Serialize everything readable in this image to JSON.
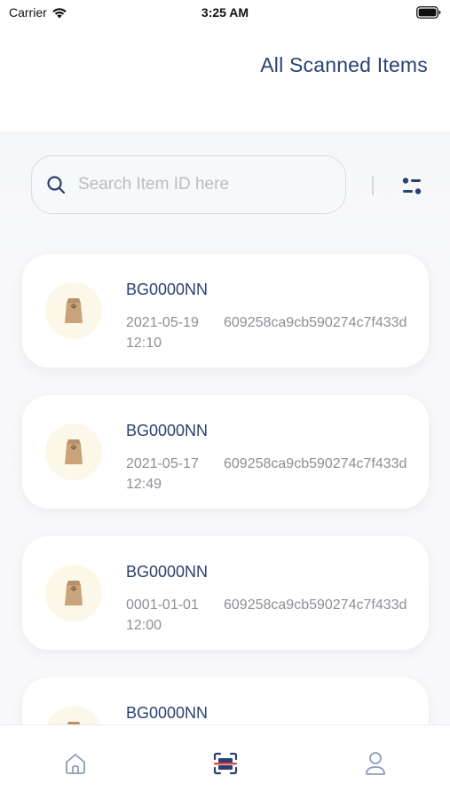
{
  "status_bar": {
    "carrier": "Carrier",
    "time": "3:25 AM"
  },
  "header": {
    "title": "All Scanned Items"
  },
  "search": {
    "placeholder": "Search Item ID here",
    "value": ""
  },
  "items": [
    {
      "id": "BG0000NN",
      "date": "2021-05-19 12:10",
      "hash": "609258ca9cb590274c7f433d"
    },
    {
      "id": "BG0000NN",
      "date": "2021-05-17 12:49",
      "hash": "609258ca9cb590274c7f433d"
    },
    {
      "id": "BG0000NN",
      "date": "0001-01-01 12:00",
      "hash": "609258ca9cb590274c7f433d"
    },
    {
      "id": "BG0000NN",
      "date": "",
      "hash": ""
    }
  ],
  "tabs": [
    {
      "icon": "home-icon",
      "active": false
    },
    {
      "icon": "scan-icon",
      "active": true
    },
    {
      "icon": "profile-icon",
      "active": false
    }
  ],
  "colors": {
    "accent": "#2b4170",
    "scan_red": "#e04646",
    "bag": "#c9a47a",
    "thumb_bg": "#fbf8ea"
  }
}
